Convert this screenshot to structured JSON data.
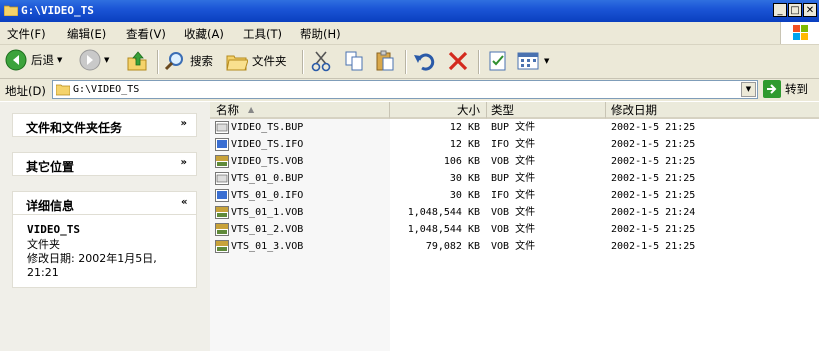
{
  "window": {
    "title": "G:\\VIDEO_TS"
  },
  "menu": [
    {
      "label": "文件(F)"
    },
    {
      "label": "编辑(E)"
    },
    {
      "label": "查看(V)"
    },
    {
      "label": "收藏(A)"
    },
    {
      "label": "工具(T)"
    },
    {
      "label": "帮助(H)"
    }
  ],
  "toolbar": {
    "back": "后退",
    "search": "搜索",
    "folders": "文件夹"
  },
  "address": {
    "label": "地址(D)",
    "path": "G:\\VIDEO_TS",
    "go": "转到"
  },
  "taskpane": {
    "file_tasks": "文件和文件夹任务",
    "other_places": "其它位置",
    "details": "详细信息",
    "detail_name": "VIDEO_TS",
    "detail_type": "文件夹",
    "detail_modified": "修改日期: 2002年1月5日, 21:21"
  },
  "columns": {
    "name": "名称",
    "size": "大小",
    "type": "类型",
    "date": "修改日期"
  },
  "files": [
    {
      "name": "VIDEO_TS.BUP",
      "size": "12 KB",
      "type": "BUP 文件",
      "date": "2002-1-5 21:25",
      "icon": "bup-file-icon"
    },
    {
      "name": "VIDEO_TS.IFO",
      "size": "12 KB",
      "type": "IFO 文件",
      "date": "2002-1-5 21:25",
      "icon": "ifo-file-icon"
    },
    {
      "name": "VIDEO_TS.VOB",
      "size": "106 KB",
      "type": "VOB 文件",
      "date": "2002-1-5 21:25",
      "icon": "vob-file-icon"
    },
    {
      "name": "VTS_01_0.BUP",
      "size": "30 KB",
      "type": "BUP 文件",
      "date": "2002-1-5 21:25",
      "icon": "bup-file-icon"
    },
    {
      "name": "VTS_01_0.IFO",
      "size": "30 KB",
      "type": "IFO 文件",
      "date": "2002-1-5 21:25",
      "icon": "ifo-file-icon"
    },
    {
      "name": "VTS_01_1.VOB",
      "size": "1,048,544 KB",
      "type": "VOB 文件",
      "date": "2002-1-5 21:24",
      "icon": "vob-file-icon"
    },
    {
      "name": "VTS_01_2.VOB",
      "size": "1,048,544 KB",
      "type": "VOB 文件",
      "date": "2002-1-5 21:25",
      "icon": "vob-file-icon"
    },
    {
      "name": "VTS_01_3.VOB",
      "size": "79,082 KB",
      "type": "VOB 文件",
      "date": "2002-1-5 21:25",
      "icon": "vob-file-icon"
    }
  ]
}
